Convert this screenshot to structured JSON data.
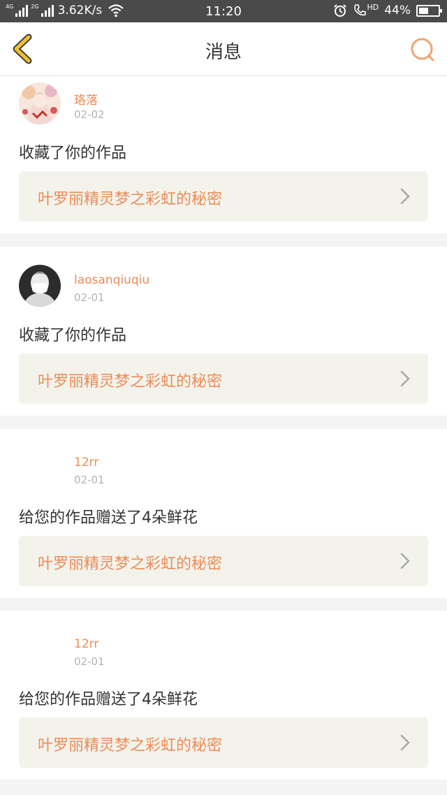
{
  "status_bar": {
    "sim1_tag": "4G",
    "sim2_tag": "2G",
    "net_speed": "3.62K/s",
    "time": "11:20",
    "hd_label": "HD",
    "battery_text": "44%",
    "battery_level": 0.44,
    "icons": [
      "signal-icon",
      "wifi-icon",
      "alarm-icon",
      "call-icon",
      "battery-icon"
    ]
  },
  "header": {
    "title": "消息",
    "accent_color": "#f0a36f",
    "back_icon_color": "#f3c02b"
  },
  "messages": [
    {
      "username": "珞落",
      "date": "02-02",
      "action": "收藏了你的作品",
      "work_title": "叶罗丽精灵梦之彩虹的秘密",
      "avatar": "anime-girl-avatar"
    },
    {
      "username": "laosanqiuqiu",
      "date": "02-01",
      "action": "收藏了你的作品",
      "work_title": "叶罗丽精灵梦之彩虹的秘密",
      "avatar": "masked-person-avatar"
    },
    {
      "username": "12rr",
      "date": "02-01",
      "action": "给您的作品赠送了4朵鲜花",
      "work_title": "叶罗丽精灵梦之彩虹的秘密",
      "avatar": ""
    },
    {
      "username": "12rr",
      "date": "02-01",
      "action": "给您的作品赠送了4朵鲜花",
      "work_title": "叶罗丽精灵梦之彩虹的秘密",
      "avatar": ""
    }
  ]
}
